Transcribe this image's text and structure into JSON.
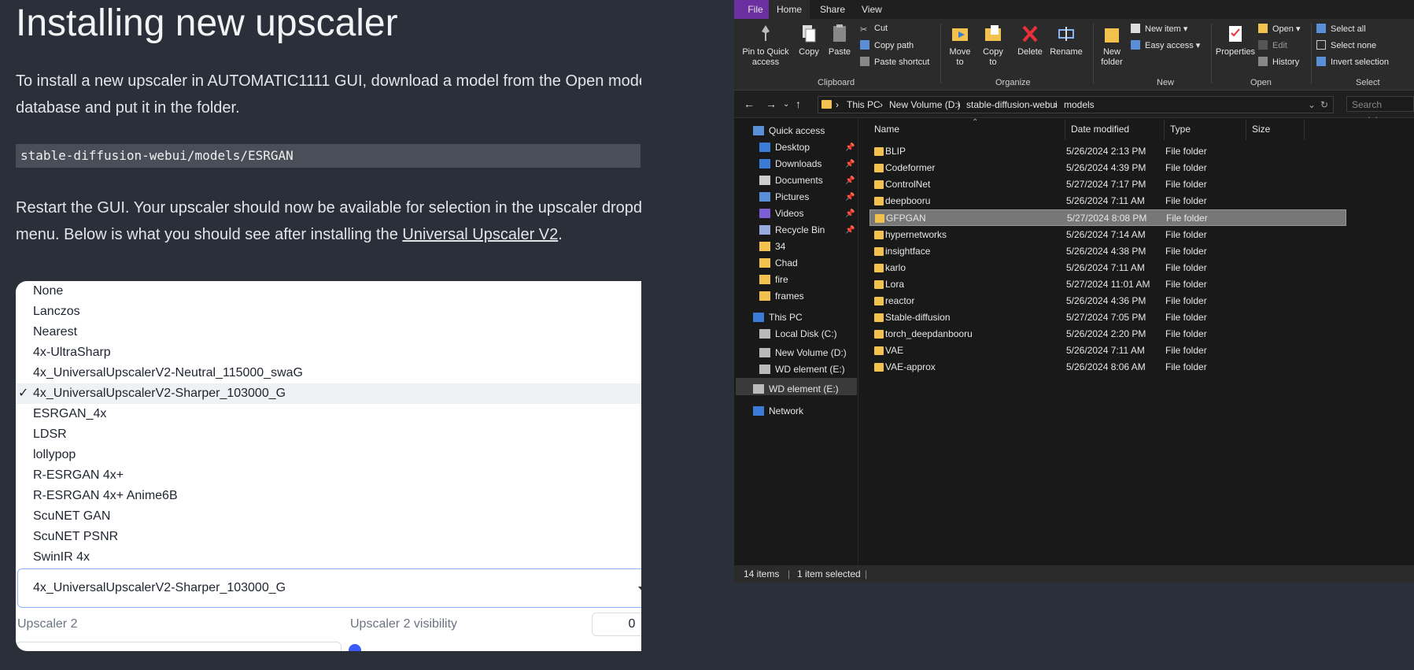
{
  "article": {
    "title": "Installing new upscaler",
    "para1_line1": "To install a new upscaler in AUTOMATIC1111 GUI, download a model from the Open mode",
    "para1_line2": "database and put it in the folder.",
    "code": "stable-diffusion-webui/models/ESRGAN",
    "para2_line1": "Restart the GUI. Your upscaler should now be available for selection in the upscaler dropdc",
    "para2_line2_prefix": "menu. Below is what you should see after installing the ",
    "para2_link": "Universal Upscaler V2",
    "para2_suffix": "."
  },
  "upscaler_ui": {
    "options": [
      "None",
      "Lanczos",
      "Nearest",
      "4x-UltraSharp",
      "4x_UniversalUpscalerV2-Neutral_115000_swaG",
      "4x_UniversalUpscalerV2-Sharper_103000_G",
      "ESRGAN_4x",
      "LDSR",
      "lollypop",
      "R-ESRGAN 4x+",
      "R-ESRGAN 4x+ Anime6B",
      "ScuNET GAN",
      "ScuNET PSNR",
      "SwinIR 4x"
    ],
    "selected_check": "✓",
    "selected_value": "4x_UniversalUpscalerV2-Sharper_103000_G",
    "upscaler2_label": "Upscaler 2",
    "upscaler2_visibility_label": "Upscaler 2 visibility",
    "upscaler2_visibility_value": "0"
  },
  "explorer": {
    "tabs": [
      "File",
      "Home",
      "Share",
      "View"
    ],
    "ribbon": {
      "pin_label_1": "Pin to Quick",
      "pin_label_2": "access",
      "copy": "Copy",
      "paste": "Paste",
      "cut": "Cut",
      "copy_path": "Copy path",
      "paste_shortcut": "Paste shortcut",
      "clipboard_group": "Clipboard",
      "move_to_1": "Move",
      "move_to_2": "to",
      "copy_to_1": "Copy",
      "copy_to_2": "to",
      "delete": "Delete",
      "rename": "Rename",
      "organize_group": "Organize",
      "new_folder_1": "New",
      "new_folder_2": "folder",
      "new_item": "New item",
      "easy_access": "Easy access",
      "new_group": "New",
      "properties": "Properties",
      "open": "Open",
      "edit": "Edit",
      "history": "History",
      "open_group": "Open",
      "select_all": "Select all",
      "select_none": "Select none",
      "invert_selection": "Invert selection",
      "select_group": "Select"
    },
    "breadcrumbs": [
      "This PC",
      "New Volume (D:)",
      "stable-diffusion-webui",
      "models"
    ],
    "search_placeholder": "Search models",
    "nav": {
      "quick_access": "Quick access",
      "pinned": [
        "Desktop",
        "Downloads",
        "Documents",
        "Pictures",
        "Videos",
        "Recycle Bin"
      ],
      "folders": [
        "34",
        "Chad",
        "fire",
        "frames"
      ],
      "this_pc": "This PC",
      "drives": [
        "Local Disk (C:)",
        "New Volume (D:)",
        "WD element (E:)"
      ],
      "wd_root": "WD element (E:)",
      "network": "Network"
    },
    "columns": [
      "Name",
      "Date modified",
      "Type",
      "Size"
    ],
    "files": [
      {
        "name": "BLIP",
        "date": "5/26/2024 2:13 PM",
        "type": "File folder"
      },
      {
        "name": "Codeformer",
        "date": "5/26/2024 4:39 PM",
        "type": "File folder"
      },
      {
        "name": "ControlNet",
        "date": "5/27/2024 7:17 PM",
        "type": "File folder"
      },
      {
        "name": "deepbooru",
        "date": "5/26/2024 7:11 AM",
        "type": "File folder"
      },
      {
        "name": "GFPGAN",
        "date": "5/27/2024 8:08 PM",
        "type": "File folder"
      },
      {
        "name": "hypernetworks",
        "date": "5/26/2024 7:14 AM",
        "type": "File folder"
      },
      {
        "name": "insightface",
        "date": "5/26/2024 4:38 PM",
        "type": "File folder"
      },
      {
        "name": "karlo",
        "date": "5/26/2024 7:11 AM",
        "type": "File folder"
      },
      {
        "name": "Lora",
        "date": "5/27/2024 11:01 AM",
        "type": "File folder"
      },
      {
        "name": "reactor",
        "date": "5/26/2024 4:36 PM",
        "type": "File folder"
      },
      {
        "name": "Stable-diffusion",
        "date": "5/27/2024 7:05 PM",
        "type": "File folder"
      },
      {
        "name": "torch_deepdanbooru",
        "date": "5/26/2024 2:20 PM",
        "type": "File folder"
      },
      {
        "name": "VAE",
        "date": "5/26/2024 7:11 AM",
        "type": "File folder"
      },
      {
        "name": "VAE-approx",
        "date": "5/26/2024 8:06 AM",
        "type": "File folder"
      }
    ],
    "status_items": "14 items",
    "status_selected": "1 item selected",
    "colors": {
      "file_tab": "#6b2fa0",
      "folder": "#f2c14e",
      "selected_row": "#777777"
    }
  }
}
